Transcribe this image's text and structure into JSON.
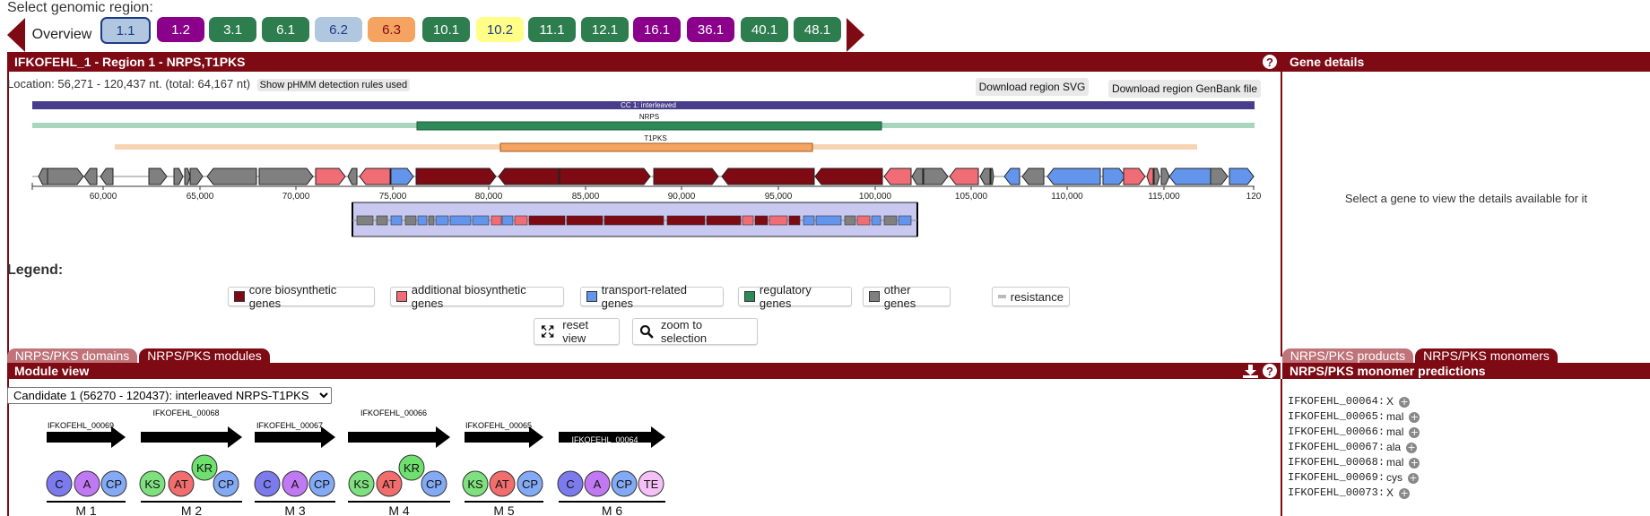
{
  "header": {
    "select_label": "Select genomic region:",
    "overview_label": "Overview",
    "regions": [
      {
        "label": "1.1",
        "bg": "#b1c7e0",
        "fg": "#1e3a8a",
        "active": true
      },
      {
        "label": "1.2",
        "bg": "#8b008b",
        "fg": "#ffffff"
      },
      {
        "label": "3.1",
        "bg": "#2e7d4f",
        "fg": "#ffffff"
      },
      {
        "label": "6.1",
        "bg": "#2e7d4f",
        "fg": "#ffffff"
      },
      {
        "label": "6.2",
        "bg": "#b1c7e0",
        "fg": "#1e3a8a"
      },
      {
        "label": "6.3",
        "bg": "#f4a460",
        "fg": "#7e0a14"
      },
      {
        "label": "10.1",
        "bg": "#2e7d4f",
        "fg": "#ffffff"
      },
      {
        "label": "10.2",
        "bg": "#ffff88",
        "fg": "#1e3a8a"
      },
      {
        "label": "11.1",
        "bg": "#2e7d4f",
        "fg": "#ffffff"
      },
      {
        "label": "12.1",
        "bg": "#2e7d4f",
        "fg": "#ffffff"
      },
      {
        "label": "16.1",
        "bg": "#8b008b",
        "fg": "#ffffff"
      },
      {
        "label": "36.1",
        "bg": "#8b008b",
        "fg": "#ffffff"
      },
      {
        "label": "40.1",
        "bg": "#2e7d4f",
        "fg": "#ffffff"
      },
      {
        "label": "48.1",
        "bg": "#2e7d4f",
        "fg": "#ffffff"
      }
    ]
  },
  "region_panel": {
    "title": "IFKOFEHL_1 - Region 1 - NRPS,T1PKS",
    "help_icon": "?",
    "location": "Location: 56,271 - 120,437 nt. (total: 64,167 nt)",
    "pmhh_button": "Show pHMM detection rules used",
    "download_svg": "Download region SVG",
    "download_genbank": "Download region GenBank file",
    "cc_label": "CC 1: interleaved",
    "nrps_label": "NRPS",
    "t1pks_label": "T1PKS",
    "axis_ticks": [
      "60,000",
      "65,000",
      "70,000",
      "75,000",
      "80,000",
      "85,000",
      "90,000",
      "95,000",
      "100,000",
      "105,000",
      "110,000",
      "115,000",
      "120"
    ],
    "colors": {
      "core": "#7e0a14",
      "additional": "#f16d75",
      "transport": "#6495ed",
      "regulatory": "#2e8b57",
      "other": "#808080",
      "cc": "#483d8b",
      "nrps": "#2e8b57",
      "t1pks": "#f4a460"
    }
  },
  "legend": {
    "title": "Legend:",
    "items": [
      {
        "label": "core biosynthetic genes",
        "color": "#7e0a14"
      },
      {
        "label": "additional biosynthetic genes",
        "color": "#f16d75"
      },
      {
        "label": "transport-related genes",
        "color": "#6495ed"
      },
      {
        "label": "regulatory genes",
        "color": "#2e8b57"
      },
      {
        "label": "other genes",
        "color": "#808080"
      },
      {
        "label": "resistance",
        "color": "#bbbbbb"
      }
    ],
    "reset_view": "reset view",
    "zoom_selection": "zoom to selection"
  },
  "gene_details": {
    "title": "Gene details",
    "message": "Select a gene to view the details available for it"
  },
  "left_tabs": [
    {
      "label": "NRPS/PKS domains",
      "active": false
    },
    {
      "label": "NRPS/PKS modules",
      "active": true
    }
  ],
  "right_tabs": [
    {
      "label": "NRPS/PKS products",
      "active": false
    },
    {
      "label": "NRPS/PKS monomers",
      "active": true
    }
  ],
  "module_view": {
    "title": "Module view",
    "candidate": "Candidate 1 (56270 - 120437): interleaved NRPS-T1PKS",
    "genes": [
      "IFKOFEHL_00069",
      "IFKOFEHL_00068",
      "IFKOFEHL_00067",
      "IFKOFEHL_00066",
      "IFKOFEHL_00065",
      "IFKOFEHL_00064"
    ],
    "modules": [
      {
        "label": "M 1",
        "domains": [
          "C",
          "A",
          "CP"
        ]
      },
      {
        "label": "M 2",
        "domains": [
          "KS",
          "AT",
          "KR",
          "CP"
        ]
      },
      {
        "label": "M 3",
        "domains": [
          "C",
          "A",
          "CP"
        ]
      },
      {
        "label": "M 4",
        "domains": [
          "KS",
          "AT",
          "KR",
          "CP"
        ]
      },
      {
        "label": "M 5",
        "domains": [
          "KS",
          "AT",
          "CP"
        ]
      },
      {
        "label": "M 6",
        "domains": [
          "C",
          "A",
          "CP",
          "TE"
        ]
      }
    ]
  },
  "monomers": {
    "title": "NRPS/PKS monomer predictions",
    "rows": [
      {
        "gene": "IFKOFEHL_00064:",
        "value": "X"
      },
      {
        "gene": "IFKOFEHL_00065:",
        "value": "mal"
      },
      {
        "gene": "IFKOFEHL_00066:",
        "value": "mal"
      },
      {
        "gene": "IFKOFEHL_00067:",
        "value": "ala"
      },
      {
        "gene": "IFKOFEHL_00068:",
        "value": "mal"
      },
      {
        "gene": "IFKOFEHL_00069:",
        "value": "cys"
      },
      {
        "gene": "IFKOFEHL_00073:",
        "value": "X"
      }
    ]
  }
}
